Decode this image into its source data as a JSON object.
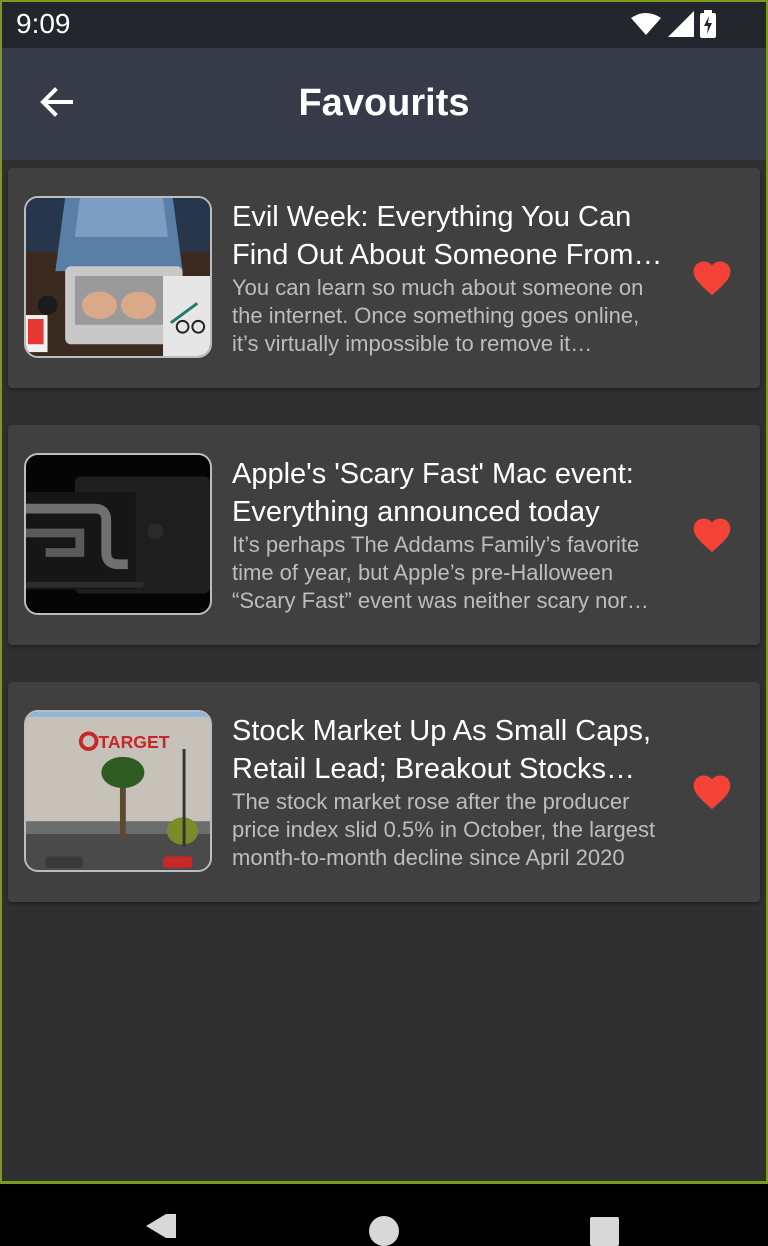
{
  "status_bar": {
    "time": "9:09",
    "icons": [
      "wifi-icon",
      "signal-icon",
      "battery-charging-icon"
    ]
  },
  "app_bar": {
    "title": "Favourits",
    "back_icon": "arrow-left-icon"
  },
  "favourites": [
    {
      "title": "Evil Week: Everything You Can Find Out About Someone From the Internet",
      "description": "You can learn so much about someone on the internet. Once something goes online, it’s virtually impossible to remove it completely",
      "thumbnail": "person-typing-on-laptop",
      "favourite_icon": "heart-icon"
    },
    {
      "title": "Apple's 'Scary Fast' Mac event: Everything announced today",
      "description": "It’s perhaps The Addams Family’s favorite time of year, but Apple’s pre-Halloween “Scary Fast” event was neither scary nor long",
      "thumbnail": "black-macbook-m3",
      "favourite_icon": "heart-icon"
    },
    {
      "title": "Stock Market Up As Small Caps, Retail Lead; Breakout Stocks Rally",
      "description": "The stock market rose after the producer price index slid 0.5% in October, the largest month-to-month decline since April 2020",
      "thumbnail": "target-store-building",
      "thumbnail_sign": "TARGET",
      "favourite_icon": "heart-icon"
    }
  ],
  "colors": {
    "heart": "#f44336",
    "card": "#404040",
    "background": "#303030",
    "app_bar": "#373a48"
  }
}
